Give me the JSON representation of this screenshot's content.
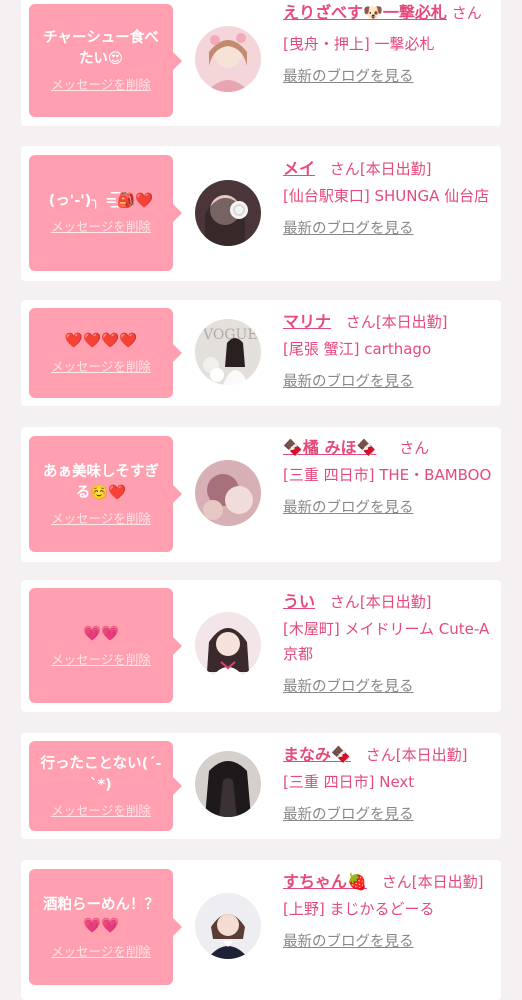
{
  "delete_label": "メッセージを削除",
  "blog_label": "最新のブログを見る",
  "san_label": "さん",
  "cards": [
    {
      "message": "チャーシュー食べたい😍",
      "name": "えりざべす🐶一撃必札",
      "status": "",
      "shop": "[曳舟・押上] 一撃必札",
      "avatar_color": "#e9c5c9"
    },
    {
      "message": "(っ'-')╮ =͟͟͞͞🎒❤️",
      "name": "メイ",
      "status": "[本日出勤]",
      "shop": "[仙台駅東口] SHUNGA 仙台店",
      "avatar_color": "#5c4448"
    },
    {
      "message": "❤️❤️❤️❤️",
      "name": "マリナ",
      "status": "[本日出勤]",
      "shop": "[尾張 蟹江] carthago",
      "avatar_color": "#d8d2cc"
    },
    {
      "message": "あぁ美味しそすぎる☺️❤️",
      "name": "🍫橘 みほ🍫",
      "status": "",
      "shop": "[三重 四日市] THE・BAMBOO",
      "avatar_color": "#c99aa0"
    },
    {
      "message": "💗💗",
      "name": "うい",
      "status": "[本日出勤]",
      "shop": "[木屋町] メイドリーム Cute-A 京都",
      "avatar_color": "#f0e4e6"
    },
    {
      "message": "行ったことない(´-`*)",
      "name": "まなみ🍫",
      "status": "[本日出勤]",
      "shop": "[三重 四日市] Next",
      "avatar_color": "#3a3336"
    },
    {
      "message": "酒粕らーめん！？💗💗",
      "name": "すちゃん🍓",
      "status": "[本日出勤]",
      "shop": "[上野] まじかるどーる",
      "avatar_color": "#eaeaf0"
    }
  ]
}
